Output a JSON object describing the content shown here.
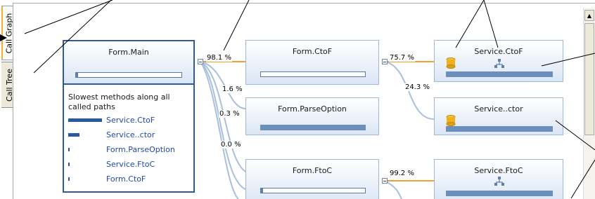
{
  "tabs": [
    {
      "label": "Call Graph",
      "active": true
    },
    {
      "label": "Call Tree",
      "active": false
    }
  ],
  "nodes": {
    "form_main": {
      "title": "Form.Main",
      "bar_fill": 0.02
    },
    "form_ctof": {
      "title": "Form.CtoF",
      "bar_fill": 0.0
    },
    "form_parseoption": {
      "title": "Form.ParseOption"
    },
    "form_ftoc": {
      "title": "Form.FtoC",
      "bar_fill": 0.02
    },
    "service_ctof": {
      "title": "Service.CtoF",
      "icons": [
        "database-icon",
        "network-icon"
      ]
    },
    "service_ctor": {
      "title": "Service..ctor",
      "icons": [
        "database-icon"
      ]
    },
    "service_ftoc": {
      "title": "Service.FtoC",
      "icons": [
        "network-icon"
      ]
    }
  },
  "edges": {
    "main_ctof": "98.1 %",
    "main_parseoption": "1.6 %",
    "main_ftoc_a": "0.3 %",
    "main_ftoc_b": "0.0 %",
    "ctof_service_ctof": "75.7 %",
    "ctof_service_ctor": "24.3 %",
    "ftoc_service_ftoc": "99.2 %"
  },
  "slowest": {
    "header": "Slowest methods along all called paths",
    "items": [
      {
        "name": "Service.CtoF",
        "weight": 0.75
      },
      {
        "name": "Service..ctor",
        "weight": 0.24
      },
      {
        "name": "Form.ParseOption",
        "weight": 0.01
      },
      {
        "name": "Service.FtoC",
        "weight": 0.01
      },
      {
        "name": "Form.CtoF",
        "weight": 0.01
      }
    ]
  },
  "colors": {
    "hot_path": "#f0a030",
    "cold_path": "#a8c0de",
    "accent": "#2f5a9e"
  }
}
